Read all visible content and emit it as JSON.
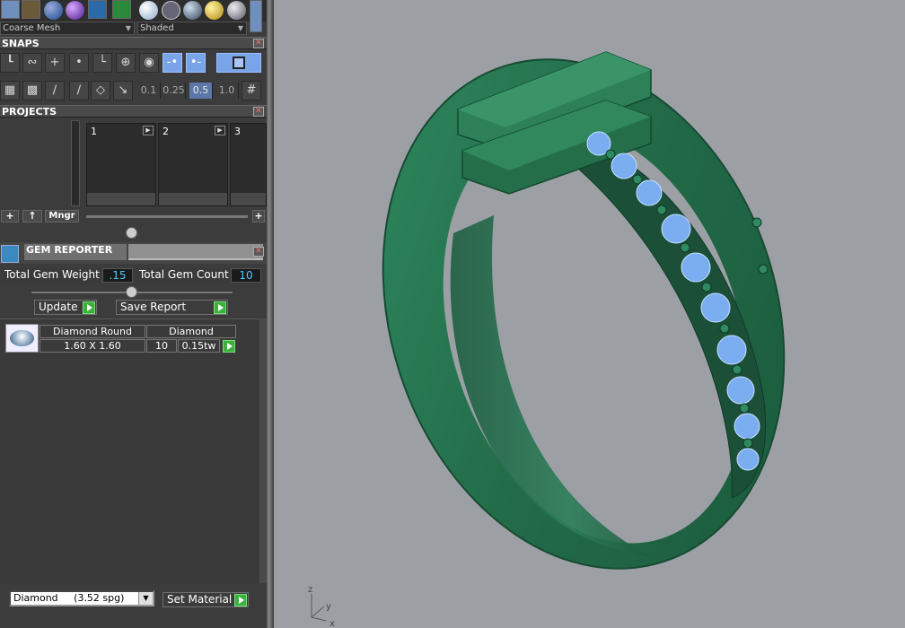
{
  "toolbar": {
    "mesh_combo": "Coarse Mesh",
    "shade_combo": "Shaded"
  },
  "snaps": {
    "header": "SNAPS",
    "grid_values": [
      "0.1",
      "0.25",
      "0.5",
      "1.0"
    ],
    "selected_grid": "0.5"
  },
  "projects": {
    "header": "PROJECTS",
    "slots": [
      "1",
      "2",
      "3"
    ],
    "mngr_label": "Mngr"
  },
  "gem_reporter": {
    "title": "GEM REPORTER",
    "total_weight_label": "Total Gem Weight",
    "total_weight_value": ".15",
    "total_count_label": "Total Gem Count",
    "total_count_value": "10",
    "update_label": "Update",
    "save_report_label": "Save Report",
    "table": {
      "col1_header": "Diamond Round",
      "col2_header": "Diamond",
      "size": "1.60 X 1.60",
      "count": "10",
      "weight": "0.15tw"
    },
    "material_select": "Diamond     (3.52 spg)",
    "set_material_label": "Set Material"
  },
  "viewport": {
    "axes": {
      "z": "z",
      "y": "y",
      "x": "x"
    },
    "colors": {
      "background": "#9ca0a5",
      "ring_metal": "#2a7a55",
      "gem": "#7aaef0"
    }
  }
}
